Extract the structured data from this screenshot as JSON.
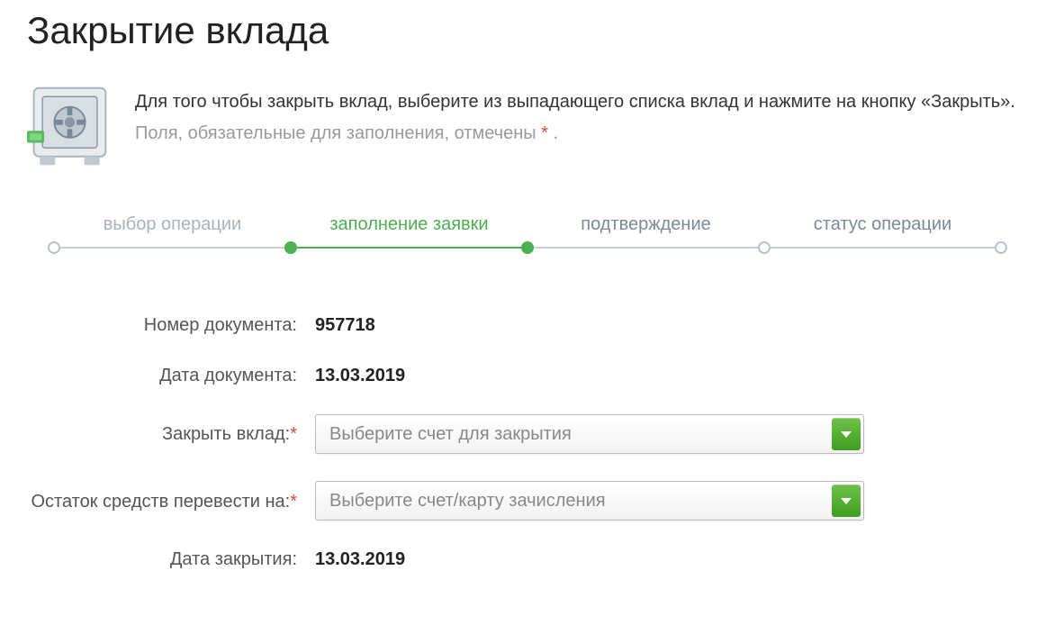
{
  "page": {
    "title": "Закрытие вклада"
  },
  "intro": {
    "main_text": "Для того чтобы закрыть вклад, выберите из выпадающего списка вклад и нажмите на кнопку «Закрыть».",
    "note_prefix": "Поля, обязательные для заполнения, отмечены ",
    "note_star": "*",
    "note_suffix": " ."
  },
  "progress": {
    "steps": [
      {
        "label": "выбор операции",
        "state": "past"
      },
      {
        "label": "заполнение заявки",
        "state": "active"
      },
      {
        "label": "подтверждение",
        "state": "upcoming"
      },
      {
        "label": "статус операции",
        "state": "upcoming"
      }
    ]
  },
  "form": {
    "doc_number": {
      "label": "Номер документа:",
      "value": "957718"
    },
    "doc_date": {
      "label": "Дата документа:",
      "value": "13.03.2019"
    },
    "close_deposit": {
      "label": "Закрыть вклад:",
      "required": "*",
      "placeholder": "Выберите счет для закрытия"
    },
    "transfer_to": {
      "label": "Остаток средств перевести на:",
      "required": "*",
      "placeholder": "Выберите счет/карту зачисления"
    },
    "close_date": {
      "label": "Дата закрытия:",
      "value": "13.03.2019"
    }
  }
}
